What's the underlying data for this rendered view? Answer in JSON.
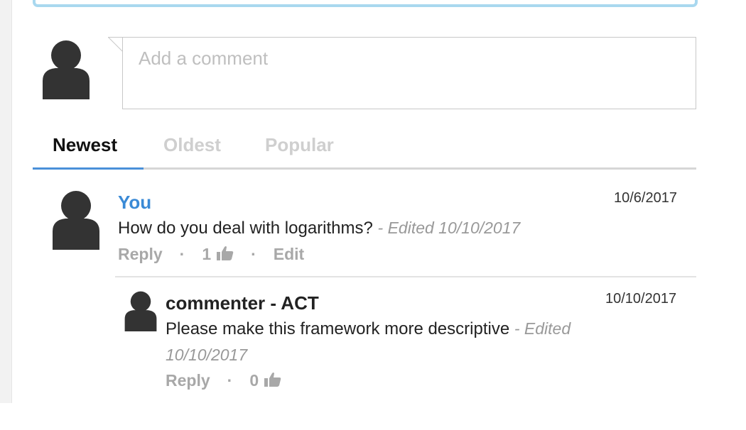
{
  "composer": {
    "placeholder": "Add a comment"
  },
  "tabs": [
    {
      "label": "Newest",
      "active": true
    },
    {
      "label": "Oldest",
      "active": false
    },
    {
      "label": "Popular",
      "active": false
    }
  ],
  "comments": [
    {
      "author": "You",
      "date": "10/6/2017",
      "text": "How do you deal with logarithms?",
      "edited": "- Edited 10/10/2017",
      "reply_label": "Reply",
      "likes": "1",
      "edit_label": "Edit",
      "separator": "·"
    },
    {
      "author": "commenter - ACT",
      "date": "10/10/2017",
      "text": "Please make this framework more descriptive",
      "edited": "- Edited 10/10/2017",
      "reply_label": "Reply",
      "likes": "0",
      "separator": "·"
    }
  ],
  "colors": {
    "accent": "#3a8ad6",
    "tab_underline": "#4a90d9",
    "avatar": "#333333",
    "muted": "#a8a8a8"
  }
}
